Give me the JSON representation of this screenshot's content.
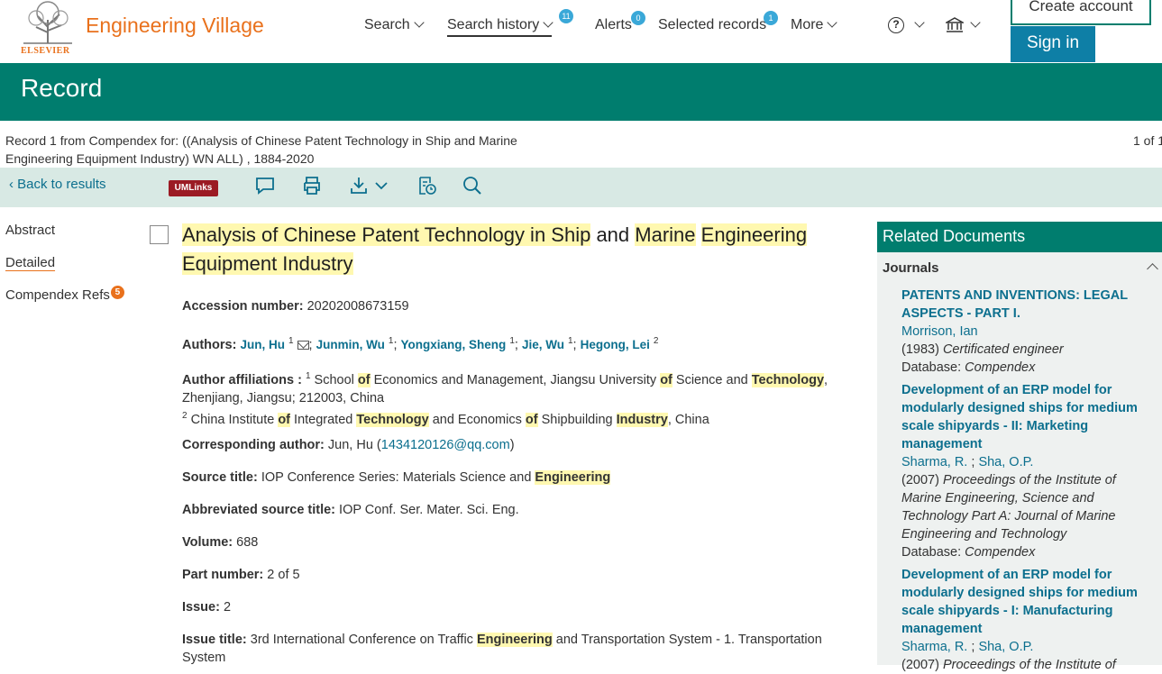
{
  "header": {
    "logo_text": "ELSEVIER",
    "brand": "Engineering Village",
    "nav": [
      {
        "label": "Search"
      },
      {
        "label": "Search history",
        "badge": "11"
      },
      {
        "label": "Alerts",
        "badge": "0"
      },
      {
        "label": "Selected records",
        "badge": "1"
      },
      {
        "label": "More"
      }
    ],
    "help_glyph": "?",
    "create_account": "Create account",
    "sign_in": "Sign in"
  },
  "banner": {
    "title": "Record"
  },
  "record_info": {
    "line": "Record 1 from Compendex for: ((Analysis of Chinese Patent Technology in Ship and Marine Engineering Equipment Industry) WN ALL) , 1884-2020",
    "pager": "1 of 1"
  },
  "toolbar": {
    "back": "Back to results",
    "umlinks": "UMLinks",
    "icons": [
      "comment-icon",
      "print-icon",
      "download-icon",
      "history-icon",
      "search-icon"
    ]
  },
  "sidebar": {
    "items": [
      {
        "label": "Abstract"
      },
      {
        "label": "Detailed"
      },
      {
        "label": "Compendex Refs",
        "badge": "5"
      }
    ]
  },
  "article": {
    "title_parts": [
      "Analysis of Chinese Patent Technology in Ship",
      " and ",
      "Marine",
      " ",
      "Engineering",
      " ",
      "Equipment Industry"
    ],
    "accession_label": "Accession number:",
    "accession": "20202008673159",
    "authors_label": "Authors:",
    "authors": [
      {
        "name": "Jun, Hu",
        "sup": "1"
      },
      {
        "name": "Junmin, Wu",
        "sup": "1"
      },
      {
        "name": "Yongxiang, Sheng",
        "sup": "1"
      },
      {
        "name": "Jie, Wu",
        "sup": "1"
      },
      {
        "name": "Hegong, Lei",
        "sup": "2"
      }
    ],
    "affil_label": "Author affiliations :",
    "affil1_sup": "1",
    "affil1": [
      "School ",
      "of",
      " Economics and Management, Jiangsu University ",
      "of",
      " Science and ",
      "Technology",
      ", Zhenjiang, Jiangsu; 212003, China"
    ],
    "affil2_sup": "2",
    "affil2": [
      "China Institute ",
      "of",
      " Integrated ",
      "Technology",
      " and Economics ",
      "of",
      " Shipbuilding ",
      "Industry",
      ", China"
    ],
    "corr_label": "Corresponding author:",
    "corr_name": "Jun, Hu (",
    "corr_email": "1434120126@qq.com",
    "corr_close": ")",
    "source_label": "Source title:",
    "source": [
      "IOP Conference Series: Materials Science and ",
      "Engineering"
    ],
    "abbr_label": "Abbreviated source title:",
    "abbr": "IOP Conf. Ser. Mater. Sci. Eng.",
    "volume_label": "Volume:",
    "volume": "688",
    "part_label": "Part number:",
    "part": "2 of 5",
    "issue_label": "Issue:",
    "issue": "2",
    "issue_title_label": "Issue title:",
    "issue_title": [
      "3rd International Conference on Traffic ",
      "Engineering",
      " and Transportation System - 1. Transportation System"
    ]
  },
  "related": {
    "heading": "Related Documents",
    "section": "Journals",
    "docs": [
      {
        "title": "PATENTS AND INVENTIONS: LEGAL ASPECTS - PART I.",
        "authors": "Morrison, Ian",
        "year": "(1983)",
        "source": "Certificated engineer",
        "db_label": "Database:",
        "db": "Compendex"
      },
      {
        "title": "Development of an ERP model for modularly designed ships for medium scale shipyards - II: Marketing management",
        "author1": "Sharma, R.",
        "author2": "Sha, O.P.",
        "year": "(2007)",
        "source": "Proceedings of the Institute of Marine Engineering, Science and Technology Part A: Journal of Marine Engineering and Technology",
        "db_label": "Database:",
        "db": "Compendex"
      },
      {
        "title": "Development of an ERP model for modularly designed ships for medium scale shipyards - I: Manufacturing management",
        "author1": "Sharma, R.",
        "author2": "Sha, O.P.",
        "year": "(2007)",
        "source": "Proceedings of the Institute of"
      }
    ]
  }
}
